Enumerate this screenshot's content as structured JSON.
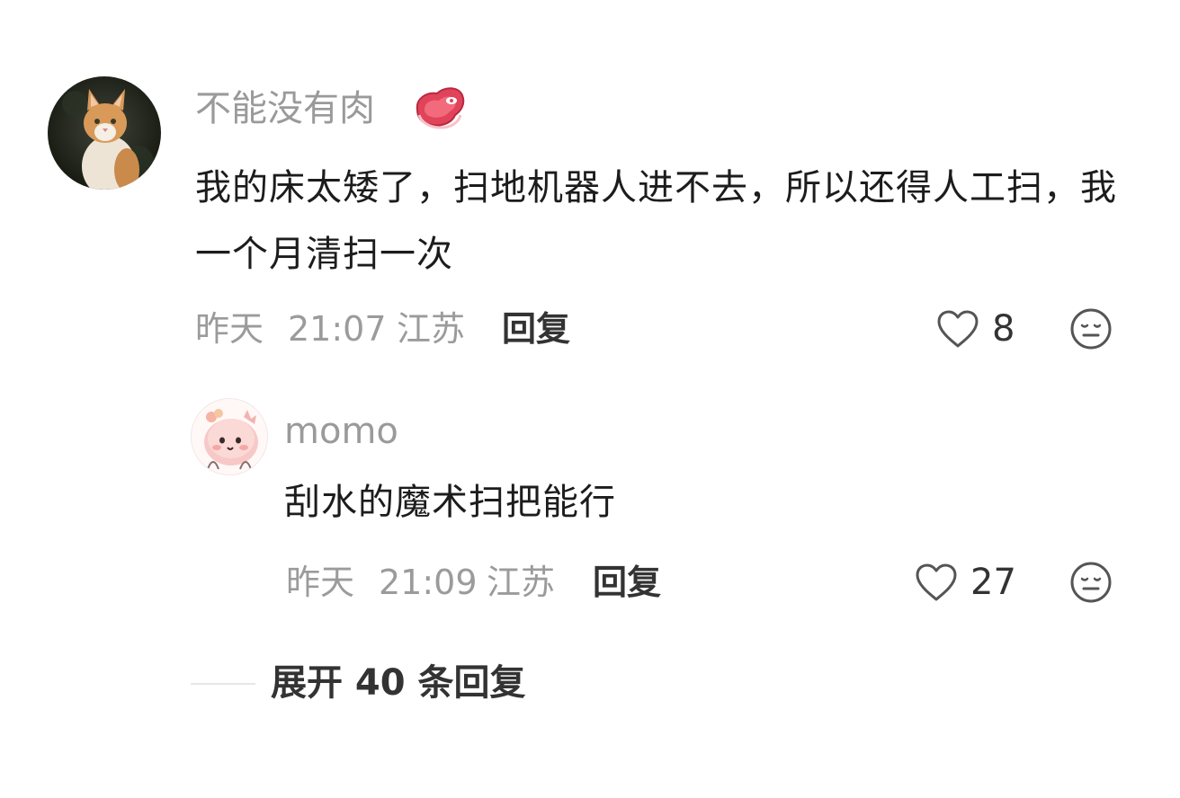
{
  "comment": {
    "username": "不能没有肉",
    "badge_icon": "steak-icon",
    "text": "我的床太矮了，扫地机器人进不去，所以还得人工扫，我一个月清扫一次",
    "date": "昨天",
    "time": "21:07",
    "location": "江苏",
    "reply_label": "回复",
    "like_count": "8"
  },
  "reply": {
    "username": "momo",
    "text": "刮水的魔术扫把能行",
    "date": "昨天",
    "time": "21:09",
    "location": "江苏",
    "reply_label": "回复",
    "like_count": "27"
  },
  "expand": {
    "label": "展开 40 条回复"
  },
  "colors": {
    "meta_gray": "#9b9b9b",
    "text_dark": "#1c1c1c",
    "badge_red": "#e0435a"
  }
}
